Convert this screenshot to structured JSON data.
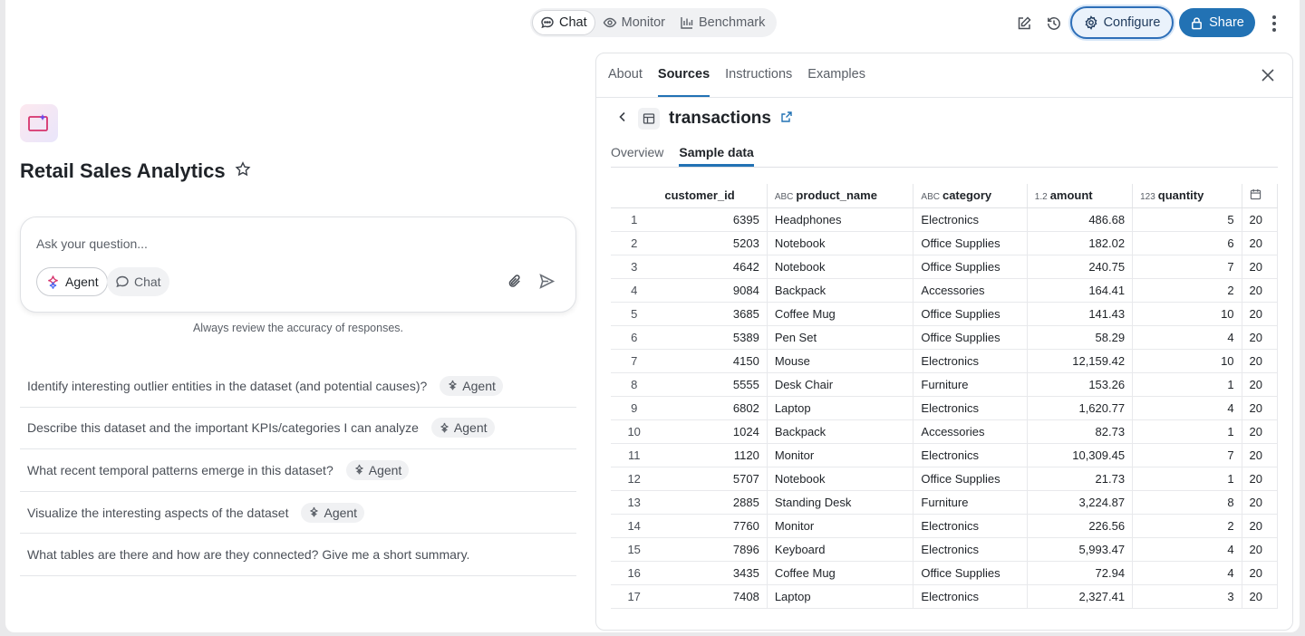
{
  "topbar": {
    "modes": [
      {
        "label": "Chat",
        "icon": "chat-bubble-icon",
        "active": true
      },
      {
        "label": "Monitor",
        "icon": "eye-icon",
        "active": false
      },
      {
        "label": "Benchmark",
        "icon": "bar-chart-icon",
        "active": false
      }
    ],
    "configure_label": "Configure",
    "share_label": "Share"
  },
  "space": {
    "title": "Retail Sales Analytics",
    "ask_placeholder": "Ask your question...",
    "agent_label": "Agent",
    "chat_label": "Chat",
    "disclaimer": "Always review the accuracy of responses."
  },
  "suggestions": [
    {
      "text": "Identify interesting outlier entities in the dataset (and potential causes)?",
      "tag": "Agent"
    },
    {
      "text": "Describe this dataset and the important KPIs/categories I can analyze",
      "tag": "Agent"
    },
    {
      "text": "What recent temporal patterns emerge in this dataset?",
      "tag": "Agent"
    },
    {
      "text": "Visualize the interesting aspects of the dataset",
      "tag": "Agent"
    },
    {
      "text": "What tables are there and how are they connected? Give me a short summary.",
      "tag": ""
    }
  ],
  "panel": {
    "tabs": [
      "About",
      "Sources",
      "Instructions",
      "Examples"
    ],
    "active_tab": "Sources",
    "table_name": "transactions",
    "subtabs": [
      "Overview",
      "Sample data"
    ],
    "active_subtab": "Sample data",
    "columns": [
      {
        "name": "customer_id",
        "type_icon": ""
      },
      {
        "name": "product_name",
        "type_icon": "ABC"
      },
      {
        "name": "category",
        "type_icon": "ABC"
      },
      {
        "name": "amount",
        "type_icon": "1.2"
      },
      {
        "name": "quantity",
        "type_icon": "123"
      },
      {
        "name": "",
        "type_icon": "calendar"
      }
    ],
    "rows": [
      [
        "1",
        "6395",
        "Headphones",
        "Electronics",
        "486.68",
        "5",
        "20"
      ],
      [
        "2",
        "5203",
        "Notebook",
        "Office Supplies",
        "182.02",
        "6",
        "20"
      ],
      [
        "3",
        "4642",
        "Notebook",
        "Office Supplies",
        "240.75",
        "7",
        "20"
      ],
      [
        "4",
        "9084",
        "Backpack",
        "Accessories",
        "164.41",
        "2",
        "20"
      ],
      [
        "5",
        "3685",
        "Coffee Mug",
        "Office Supplies",
        "141.43",
        "10",
        "20"
      ],
      [
        "6",
        "5389",
        "Pen Set",
        "Office Supplies",
        "58.29",
        "4",
        "20"
      ],
      [
        "7",
        "4150",
        "Mouse",
        "Electronics",
        "12,159.42",
        "10",
        "20"
      ],
      [
        "8",
        "5555",
        "Desk Chair",
        "Furniture",
        "153.26",
        "1",
        "20"
      ],
      [
        "9",
        "6802",
        "Laptop",
        "Electronics",
        "1,620.77",
        "4",
        "20"
      ],
      [
        "10",
        "1024",
        "Backpack",
        "Accessories",
        "82.73",
        "1",
        "20"
      ],
      [
        "11",
        "1120",
        "Monitor",
        "Electronics",
        "10,309.45",
        "7",
        "20"
      ],
      [
        "12",
        "5707",
        "Notebook",
        "Office Supplies",
        "21.73",
        "1",
        "20"
      ],
      [
        "13",
        "2885",
        "Standing Desk",
        "Furniture",
        "3,224.87",
        "8",
        "20"
      ],
      [
        "14",
        "7760",
        "Monitor",
        "Electronics",
        "226.56",
        "2",
        "20"
      ],
      [
        "15",
        "7896",
        "Keyboard",
        "Electronics",
        "5,993.47",
        "4",
        "20"
      ],
      [
        "16",
        "3435",
        "Coffee Mug",
        "Office Supplies",
        "72.94",
        "4",
        "20"
      ],
      [
        "17",
        "7408",
        "Laptop",
        "Electronics",
        "2,327.41",
        "3",
        "20"
      ]
    ]
  }
}
